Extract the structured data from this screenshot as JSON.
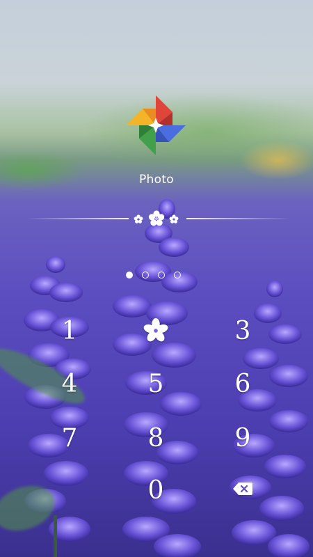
{
  "app": {
    "name": "Photo"
  },
  "pin": {
    "length": 4,
    "entered": 1
  },
  "keypad": {
    "keys": [
      {
        "label": "1",
        "name": "key-1"
      },
      {
        "label": "",
        "name": "key-2-flower-icon"
      },
      {
        "label": "3",
        "name": "key-3"
      },
      {
        "label": "4",
        "name": "key-4"
      },
      {
        "label": "5",
        "name": "key-5"
      },
      {
        "label": "6",
        "name": "key-6"
      },
      {
        "label": "7",
        "name": "key-7"
      },
      {
        "label": "8",
        "name": "key-8"
      },
      {
        "label": "9",
        "name": "key-9"
      },
      {
        "label": "0",
        "name": "key-0"
      }
    ],
    "delete_icon": "backspace-icon"
  },
  "colors": {
    "lavender": "#5c4ec0",
    "text": "#ffffff"
  }
}
